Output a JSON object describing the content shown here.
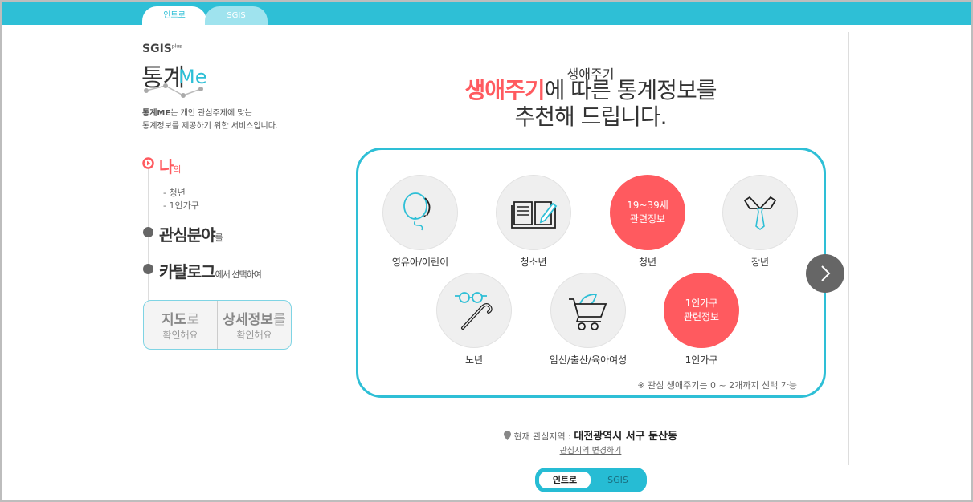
{
  "tabs": {
    "intro": "인트로",
    "sgis": "SGIS"
  },
  "logo": {
    "sgis": "SGIS",
    "plus": "plus",
    "main": "통계",
    "me": "Me"
  },
  "description": {
    "brand": "통계ME",
    "line1": "는 개인 관심주제에 맞는",
    "line2": "통계정보를 제공하기 위한 서비스입니다."
  },
  "steps": {
    "me": {
      "title": "나",
      "suffix": "의",
      "items": [
        "- 청년",
        "- 1인가구"
      ]
    },
    "interest": {
      "title": "관심분야",
      "suffix": "를"
    },
    "catalog": {
      "title": "카탈로그",
      "suffix": "에서 선택하여"
    }
  },
  "buttons": {
    "map": {
      "bold": "지도",
      "light": "로",
      "sub": "확인해요"
    },
    "detail": {
      "bold": "상세정보",
      "light": "를",
      "sub": "확인해요"
    }
  },
  "heading": {
    "small": "생애주기",
    "highlight": "생애주기",
    "rest": "에 따른 통계정보를",
    "line3": "추천해 드립니다."
  },
  "lifecycle": [
    {
      "label": "영유아/어린이",
      "icon": "balloon-icon"
    },
    {
      "label": "청소년",
      "icon": "book-icon"
    },
    {
      "label": "청년",
      "selected": true,
      "text1": "19~39세",
      "text2": "관련정보"
    },
    {
      "label": "장년",
      "icon": "tie-icon"
    },
    {
      "label": "노년",
      "icon": "glasses-cane-icon"
    },
    {
      "label": "임신/출산/육아여성",
      "icon": "stroller-icon"
    },
    {
      "label": "1인가구",
      "selected": true,
      "text1": "1인가구",
      "text2": "관련정보"
    }
  ],
  "note": "※ 관심 생애주기는 0 ~ 2개까지 선택 가능",
  "location": {
    "label": "현재 관심지역 : ",
    "value": "대전광역시 서구 둔산동",
    "change": "관심지역 변경하기"
  },
  "toggle": {
    "intro": "인트로",
    "sgis": "SGIS"
  },
  "colors": {
    "accent": "#2ebfd6",
    "selected": "#ff5a5f"
  }
}
